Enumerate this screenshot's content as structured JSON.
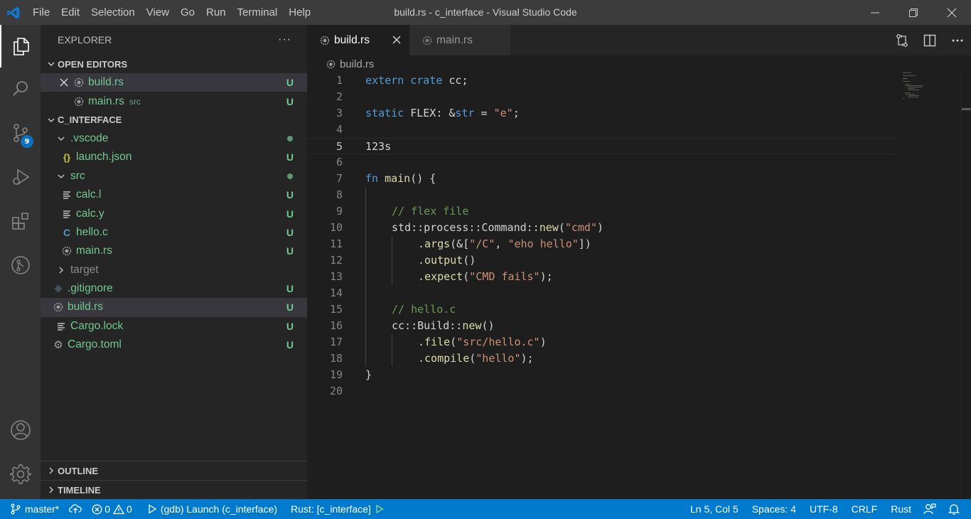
{
  "titlebar": {
    "menu": [
      "File",
      "Edit",
      "Selection",
      "View",
      "Go",
      "Run",
      "Terminal",
      "Help"
    ],
    "title": "build.rs - c_interface - Visual Studio Code"
  },
  "activitybar": {
    "scm_badge": "9"
  },
  "sidebar": {
    "header": "EXPLORER",
    "more": "···",
    "open_editors": {
      "title": "OPEN EDITORS",
      "items": [
        {
          "name": "build.rs",
          "desc": "",
          "status": "U"
        },
        {
          "name": "main.rs",
          "desc": "src",
          "status": "U"
        }
      ]
    },
    "folder": {
      "title": "C_INTERFACE",
      "items": [
        {
          "name": ".vscode",
          "status": ""
        },
        {
          "name": "launch.json",
          "status": "U"
        },
        {
          "name": "src",
          "status": ""
        },
        {
          "name": "calc.l",
          "status": "U"
        },
        {
          "name": "calc.y",
          "status": "U"
        },
        {
          "name": "hello.c",
          "status": "U"
        },
        {
          "name": "main.rs",
          "status": "U"
        },
        {
          "name": "target",
          "status": ""
        },
        {
          "name": ".gitignore",
          "status": "U"
        },
        {
          "name": "build.rs",
          "status": "U"
        },
        {
          "name": "Cargo.lock",
          "status": "U"
        },
        {
          "name": "Cargo.toml",
          "status": "U"
        }
      ]
    },
    "outline": "OUTLINE",
    "timeline": "TIMELINE"
  },
  "tabs": [
    {
      "name": "build.rs"
    },
    {
      "name": "main.rs"
    }
  ],
  "breadcrumb": "build.rs",
  "editor": {
    "line_numbers": [
      "1",
      "2",
      "3",
      "4",
      "5",
      "6",
      "7",
      "8",
      "9",
      "10",
      "11",
      "12",
      "13",
      "14",
      "15",
      "16",
      "17",
      "18",
      "19",
      "20"
    ],
    "code": {
      "l1_a": "extern",
      "l1_b": " ",
      "l1_c": "crate",
      "l1_d": " cc;",
      "l3_a": "static",
      "l3_b": " FLEX: &",
      "l3_c": "str",
      "l3_d": " = ",
      "l3_e": "\"e\"",
      "l3_f": ";",
      "l5": "123s",
      "l7_a": "fn",
      "l7_b": " ",
      "l7_c": "main",
      "l7_d": "() {",
      "l9": "// flex file",
      "l10_a": "std::process::Command::",
      "l10_b": "new",
      "l10_c": "(",
      "l10_d": "\"cmd\"",
      "l10_e": ")",
      "l11_a": ".",
      "l11_b": "args",
      "l11_c": "(&[",
      "l11_d": "\"/C\"",
      "l11_e": ", ",
      "l11_f": "\"eho hello\"",
      "l11_g": "])",
      "l12_a": ".",
      "l12_b": "output",
      "l12_c": "()",
      "l13_a": ".",
      "l13_b": "expect",
      "l13_c": "(",
      "l13_d": "\"CMD fails\"",
      "l13_e": ");",
      "l15": "// hello.c",
      "l16_a": "cc::Build::",
      "l16_b": "new",
      "l16_c": "()",
      "l17_a": ".",
      "l17_b": "file",
      "l17_c": "(",
      "l17_d": "\"src/hello.c\"",
      "l17_e": ")",
      "l18_a": ".",
      "l18_b": "compile",
      "l18_c": "(",
      "l18_d": "\"hello\"",
      "l18_e": ");",
      "l19": "}"
    }
  },
  "statusbar": {
    "branch": "master*",
    "errors": "0",
    "warnings": "0",
    "debug": "(gdb) Launch (c_interface)",
    "rust_ws": "Rust: [c_interface]",
    "position": "Ln 5, Col 5",
    "spaces": "Spaces: 4",
    "encoding": "UTF-8",
    "eol": "CRLF",
    "language": "Rust"
  },
  "colors": {
    "accent": "#007acc",
    "untracked": "#73c991",
    "keyword": "#569cd6",
    "function": "#dcdcaa",
    "string": "#ce9178",
    "comment": "#6a9955"
  }
}
